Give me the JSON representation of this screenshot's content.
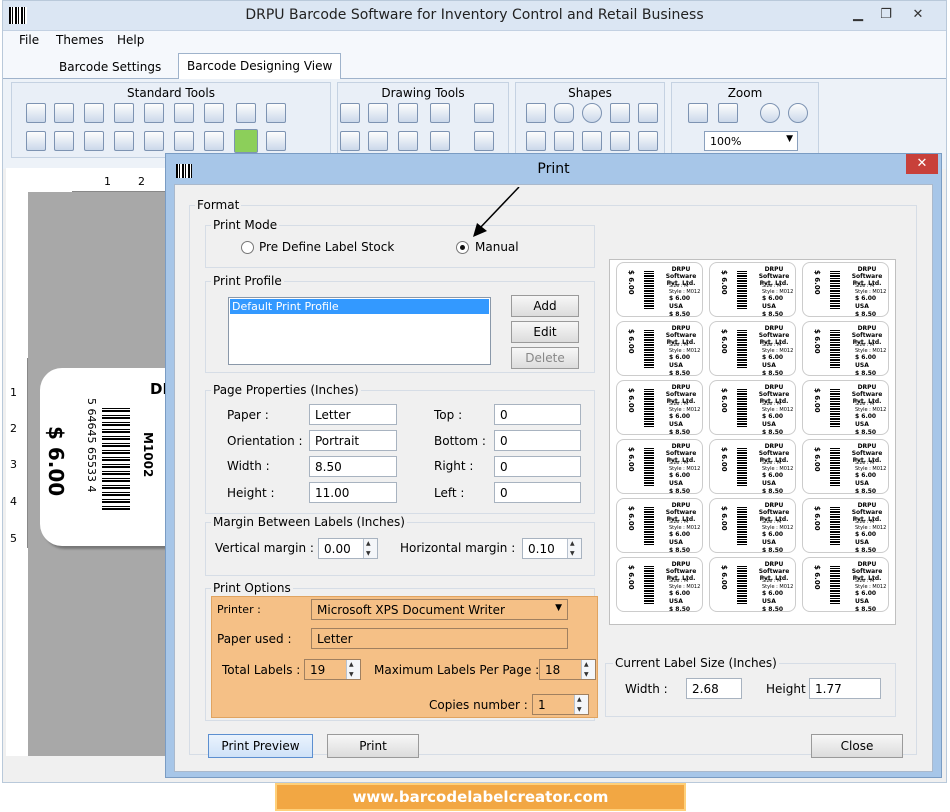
{
  "app": {
    "title": "DRPU Barcode Software for Inventory Control and Retail Business"
  },
  "menu": {
    "items": [
      "File",
      "Themes",
      "Help"
    ]
  },
  "tabs": [
    "Barcode Settings",
    "Barcode Designing View"
  ],
  "toolbar": {
    "groups": [
      "Standard Tools",
      "Drawing Tools",
      "Shapes",
      "Zoom"
    ],
    "zoom_value": "100%"
  },
  "canvas": {
    "ruler_top": [
      "1",
      "2"
    ],
    "ruler_left": [
      "1",
      "2",
      "3",
      "4",
      "5"
    ],
    "label": {
      "price": "$ 6.00",
      "barcode_digits": "5 64645 65533 4",
      "code": "M1002",
      "company_partial": "DF"
    }
  },
  "dialog": {
    "title": "Print",
    "format_legend": "Format",
    "print_mode": {
      "legend": "Print Mode",
      "option1": "Pre Define Label Stock",
      "option2": "Manual",
      "selected": "Manual"
    },
    "print_profile": {
      "legend": "Print Profile",
      "items": [
        "Default Print Profile"
      ],
      "add": "Add",
      "edit": "Edit",
      "delete": "Delete"
    },
    "page_properties": {
      "legend": "Page Properties (Inches)",
      "paper_label": "Paper :",
      "paper": "Letter",
      "orientation_label": "Orientation :",
      "orientation": "Portrait",
      "width_label": "Width :",
      "width": "8.50",
      "height_label": "Height :",
      "height": "11.00",
      "top_label": "Top :",
      "top": "0",
      "bottom_label": "Bottom :",
      "bottom": "0",
      "right_label": "Right :",
      "right": "0",
      "left_label": "Left :",
      "left": "0"
    },
    "margins": {
      "legend": "Margin Between Labels (Inches)",
      "vertical_label": "Vertical margin :",
      "vertical": "0.00",
      "horizontal_label": "Horizontal margin :",
      "horizontal": "0.10"
    },
    "print_options": {
      "legend": "Print Options",
      "printer_label": "Printer :",
      "printer": "Microsoft XPS Document Writer",
      "paper_used_label": "Paper used :",
      "paper_used": "Letter",
      "total_labels_label": "Total Labels :",
      "total_labels": "19",
      "max_labels_label": "Maximum Labels Per Page :",
      "max_labels": "18",
      "copies_label": "Copies number :",
      "copies": "1"
    },
    "preview_label": {
      "company": "DRPU Software Pvt. Ltd.",
      "size": "Size : M",
      "style": "Style : M012",
      "price_usa": "$ 6.00 USA",
      "price_can": "$ 8.50 CAN",
      "price_side": "$ 6.00",
      "count": 18
    },
    "current_size": {
      "legend": "Current Label Size (Inches)",
      "width_label": "Width :",
      "width": "2.68",
      "height_label": "Height :",
      "height": "1.77"
    },
    "buttons": {
      "preview": "Print Preview",
      "print": "Print",
      "close": "Close"
    }
  },
  "footer": {
    "url": "www.barcodelabelcreator.com"
  }
}
